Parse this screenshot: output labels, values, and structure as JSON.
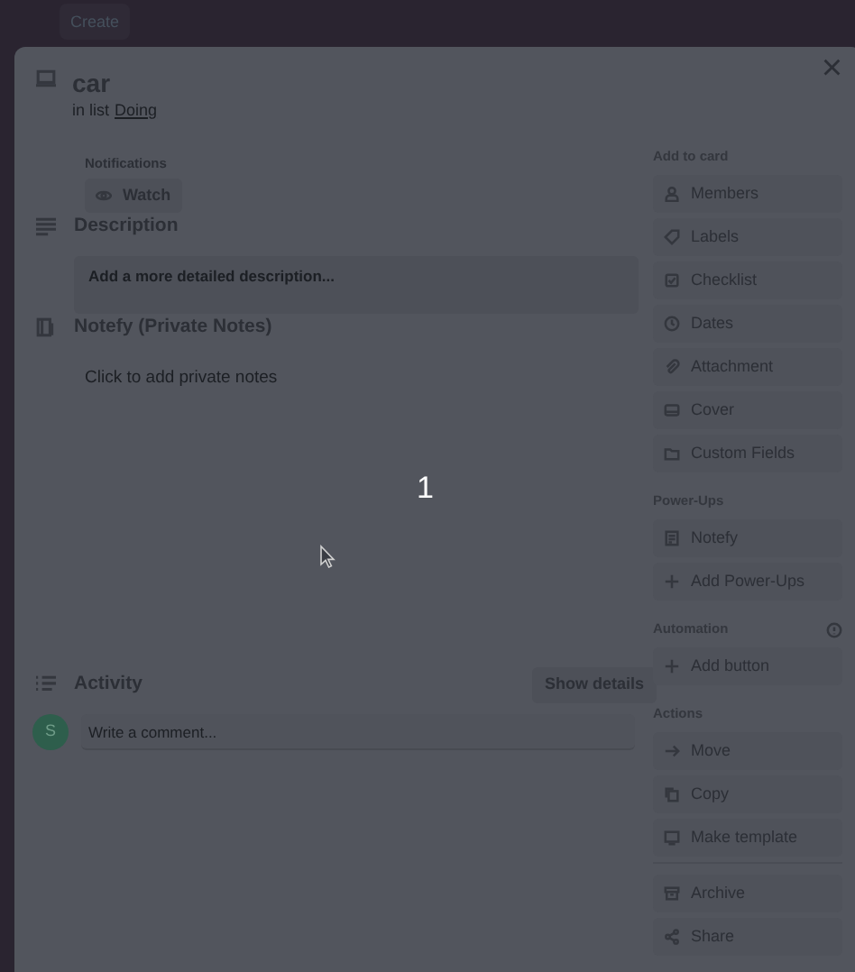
{
  "top_bar": {
    "create_button": "Create"
  },
  "card": {
    "title": "car",
    "list_prefix": "in list",
    "list_name": "Doing",
    "close": "×",
    "notifications": {
      "label": "Notifications",
      "watch_button": "Watch"
    },
    "description": {
      "heading": "Description",
      "placeholder": "Add a more detailed description..."
    },
    "notefy": {
      "heading": "Notefy (Private Notes)",
      "placeholder": "Click to add private notes"
    },
    "activity": {
      "heading": "Activity",
      "show_details_button": "Show details",
      "comment_placeholder": "Write a comment...",
      "avatar_initial": "S"
    }
  },
  "sidebar": [
    {
      "title": "Add to card",
      "items": [
        "Members",
        "Labels",
        "Checklist",
        "Dates",
        "Attachment",
        "Cover",
        "Custom Fields"
      ]
    },
    {
      "title": "Power-Ups",
      "items": [
        "Notefy",
        "Add Power-Ups"
      ]
    },
    {
      "title": "Automation",
      "info": true,
      "items": [
        "Add button"
      ]
    },
    {
      "title": "Actions",
      "items": [
        "Move",
        "Copy",
        "Make template",
        "Archive",
        "Share"
      ]
    }
  ],
  "overlay_number": "1"
}
